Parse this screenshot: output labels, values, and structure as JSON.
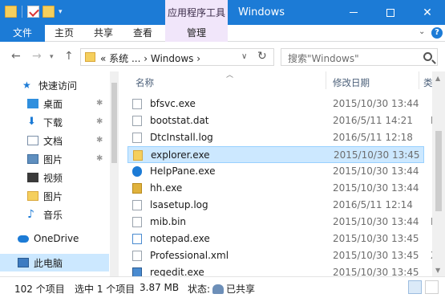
{
  "window": {
    "title": "Windows",
    "contextual_tab_title": "应用程序工具"
  },
  "ribbon_tabs": {
    "file": "文件",
    "home": "主页",
    "share": "共享",
    "view": "查看",
    "manage": "管理"
  },
  "address_bar": {
    "path": "« 系统 ... › Windows ›",
    "search_placeholder": "搜索\"Windows\""
  },
  "sidebar": {
    "items": [
      {
        "label": "快速访问",
        "icon": "star-icon",
        "pinned": false
      },
      {
        "label": "桌面",
        "icon": "desktop-icon",
        "pinned": true
      },
      {
        "label": "下载",
        "icon": "download-icon",
        "pinned": true
      },
      {
        "label": "文档",
        "icon": "document-icon",
        "pinned": true
      },
      {
        "label": "图片",
        "icon": "pictures-icon",
        "pinned": true
      },
      {
        "label": "视频",
        "icon": "video-icon",
        "pinned": false
      },
      {
        "label": "图片",
        "icon": "folder-icon",
        "pinned": false
      },
      {
        "label": "音乐",
        "icon": "music-icon",
        "pinned": false
      },
      {
        "label": "OneDrive",
        "icon": "cloud-icon",
        "pinned": false
      },
      {
        "label": "此电脑",
        "icon": "computer-icon",
        "pinned": false,
        "selected": true
      }
    ]
  },
  "file_list": {
    "columns": {
      "name": "名称",
      "date": "修改日期",
      "type": "类"
    },
    "rows": [
      {
        "name": "bfsvc.exe",
        "date": "2015/10/30 13:44",
        "type": ""
      },
      {
        "name": "bootstat.dat",
        "date": "2016/5/11 14:21",
        "type": "D"
      },
      {
        "name": "DtcInstall.log",
        "date": "2016/5/11 12:18",
        "type": ""
      },
      {
        "name": "explorer.exe",
        "date": "2015/10/30 13:45",
        "type": "",
        "selected": true
      },
      {
        "name": "HelpPane.exe",
        "date": "2015/10/30 13:44",
        "type": ""
      },
      {
        "name": "hh.exe",
        "date": "2015/10/30 13:44",
        "type": ""
      },
      {
        "name": "lsasetup.log",
        "date": "2016/5/11 12:14",
        "type": ""
      },
      {
        "name": "mib.bin",
        "date": "2015/10/30 13:44",
        "type": "B"
      },
      {
        "name": "notepad.exe",
        "date": "2015/10/30 13:45",
        "type": ""
      },
      {
        "name": "Professional.xml",
        "date": "2015/10/30 13:45",
        "type": "X"
      },
      {
        "name": "regedit.exe",
        "date": "2015/10/30 13:45",
        "type": ""
      }
    ]
  },
  "status_bar": {
    "item_count": "102 个项目",
    "selected": "选中 1 个项目",
    "size": "3.87 MB",
    "state_label": "状态:",
    "state_value": "已共享"
  },
  "colors": {
    "title_bar": "#1c7bd6",
    "contextual": "#f1e6fa",
    "selection": "#cce8ff"
  }
}
